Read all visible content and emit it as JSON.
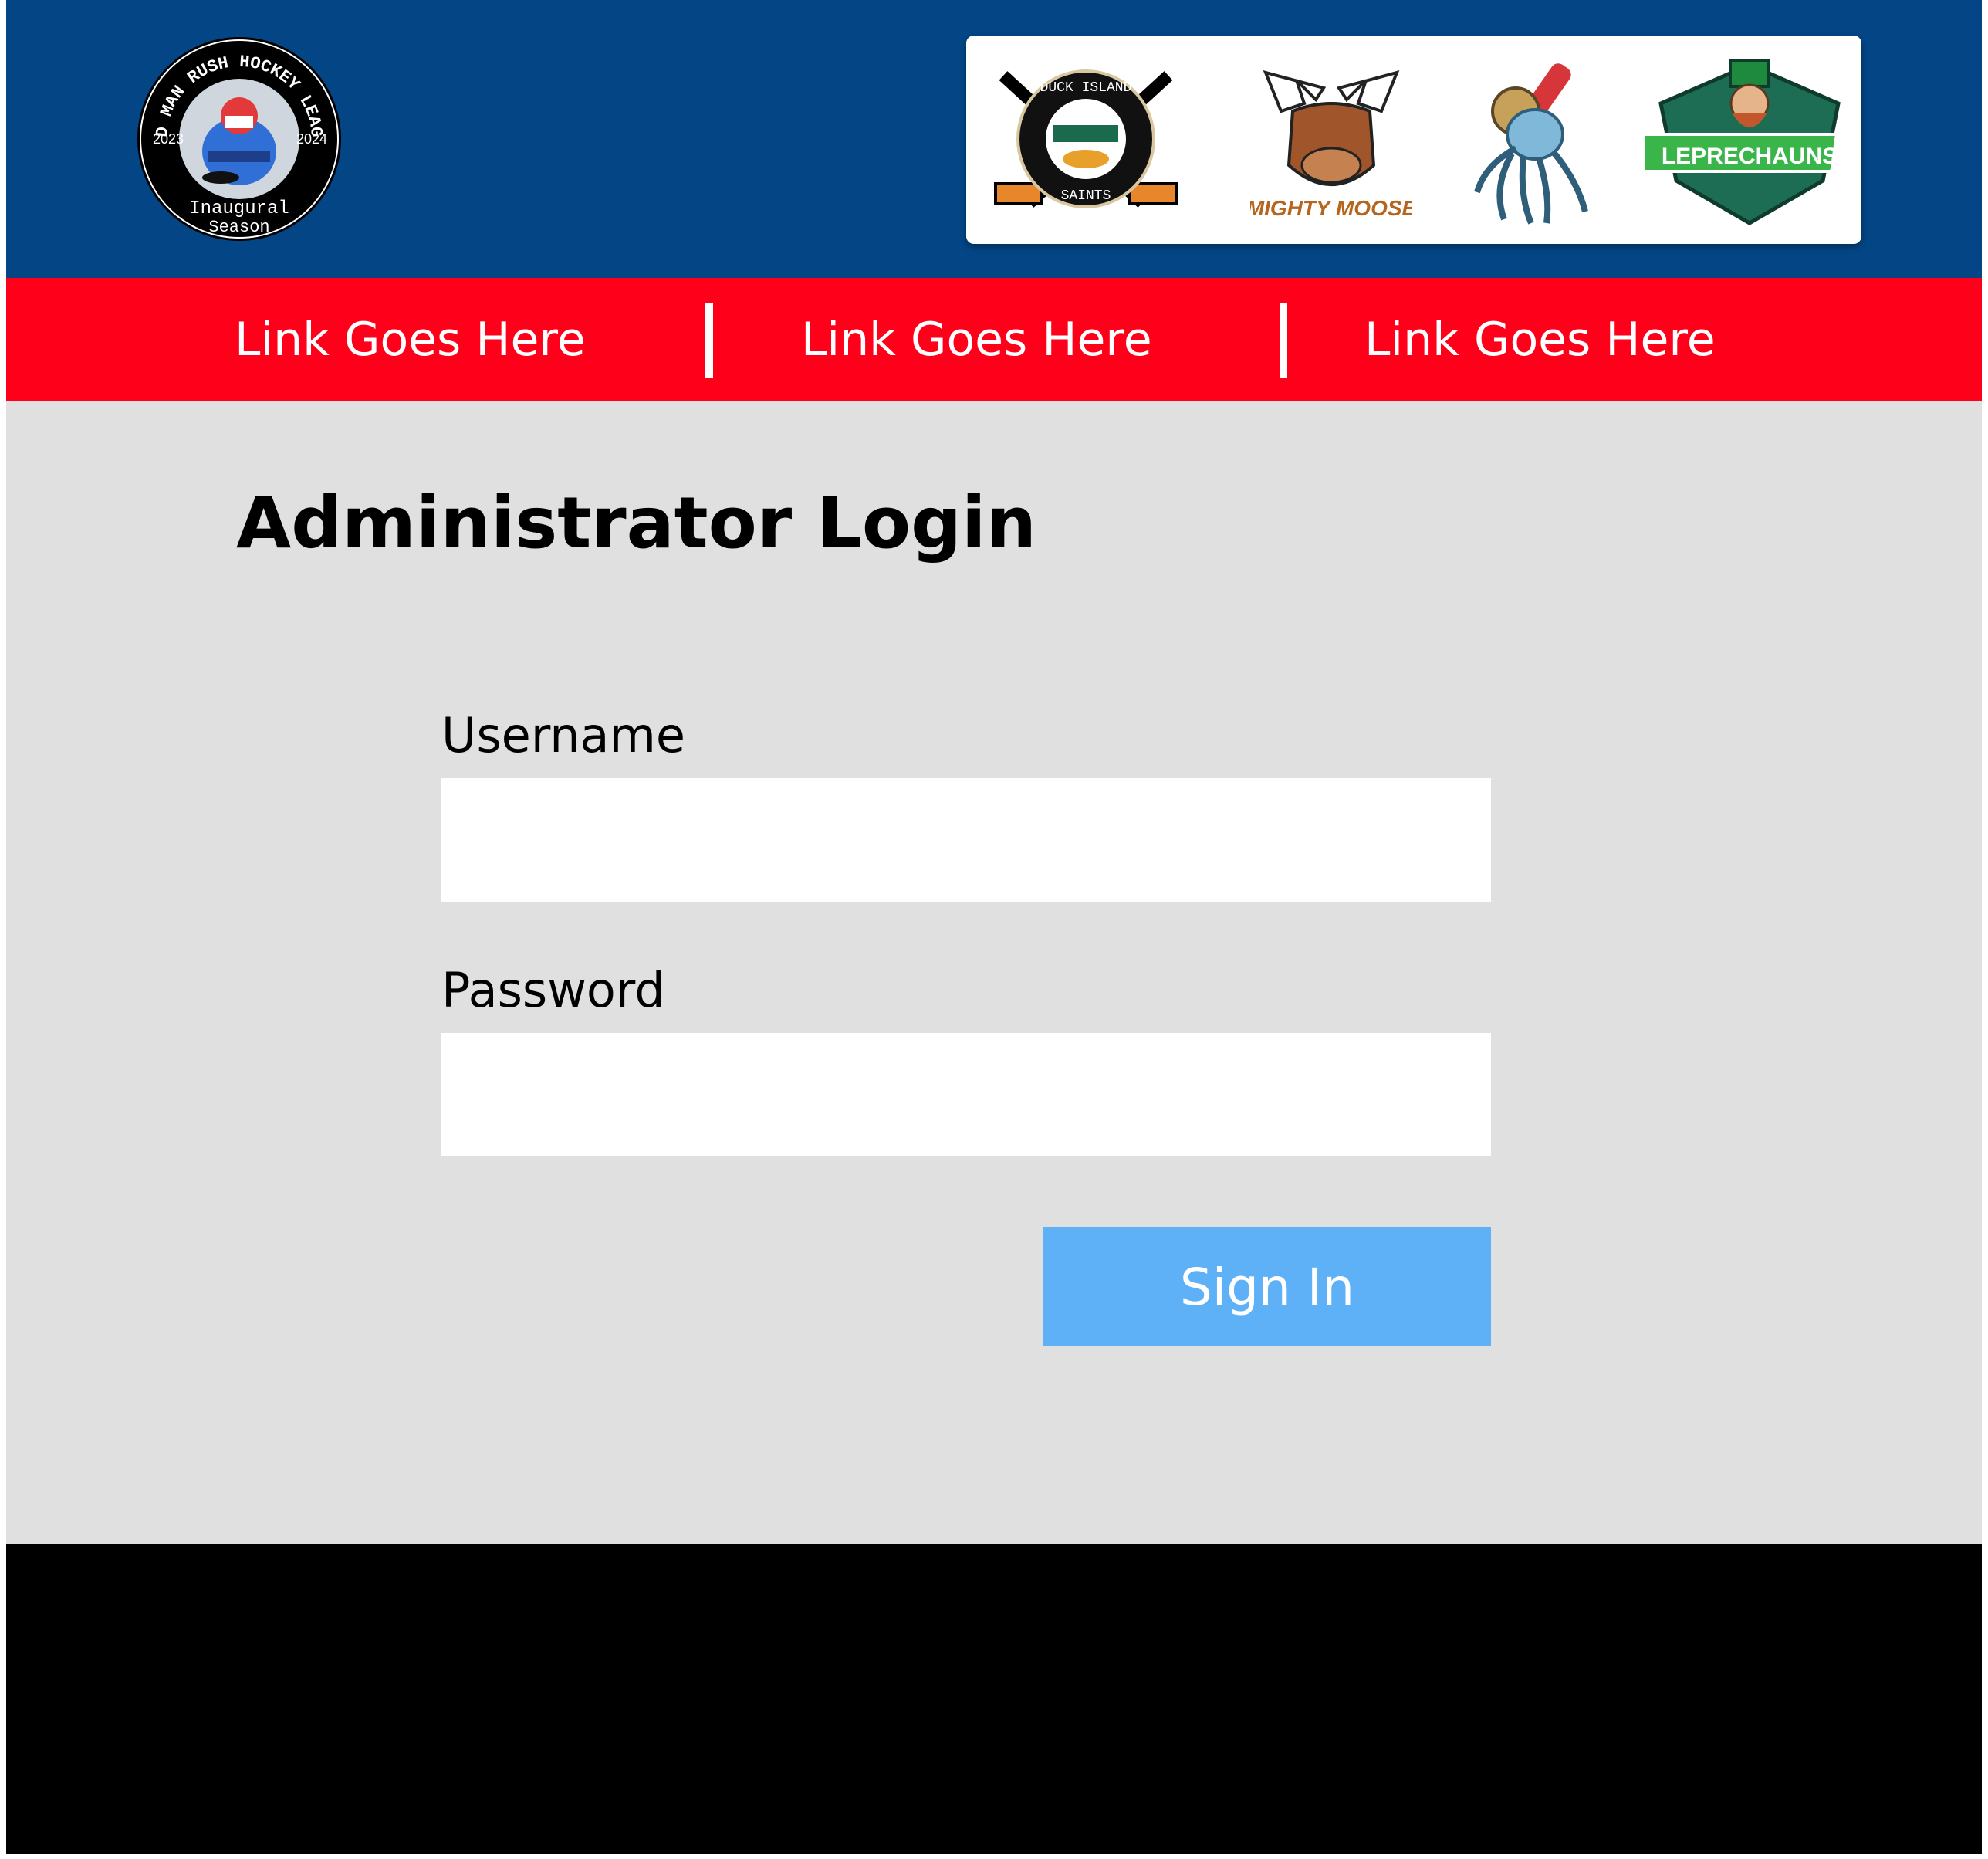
{
  "header": {
    "league_logo": {
      "icon": "odd-man-rush-hockey-league-logo",
      "top_text": "ODD MAN RUSH HOCKEY LEAGUE",
      "left_year": "2023",
      "right_year": "2024",
      "bottom_text_1": "Inaugural",
      "bottom_text_2": "Season"
    },
    "team_logos": [
      {
        "icon": "duck-island-saints-logo",
        "text_top": "DUCK ISLAND",
        "text_bottom": "SAINTS"
      },
      {
        "icon": "mighty-moose-logo",
        "text": "MIGHTY MOOSE"
      },
      {
        "icon": "octopus-team-logo"
      },
      {
        "icon": "leprechauns-logo",
        "text": "LEPRECHAUNS"
      }
    ]
  },
  "nav": {
    "links": [
      {
        "label": "Link Goes Here"
      },
      {
        "label": "Link Goes Here"
      },
      {
        "label": "Link Goes Here"
      }
    ]
  },
  "main": {
    "title": "Administrator Login",
    "form": {
      "username_label": "Username",
      "username_value": "",
      "password_label": "Password",
      "password_value": "",
      "submit_label": "Sign In"
    }
  },
  "colors": {
    "header_bg": "#034585",
    "nav_bg": "#ff001a",
    "main_bg": "#e0e0e0",
    "button_bg": "#5fb1f7",
    "footer_bg": "#000000"
  }
}
